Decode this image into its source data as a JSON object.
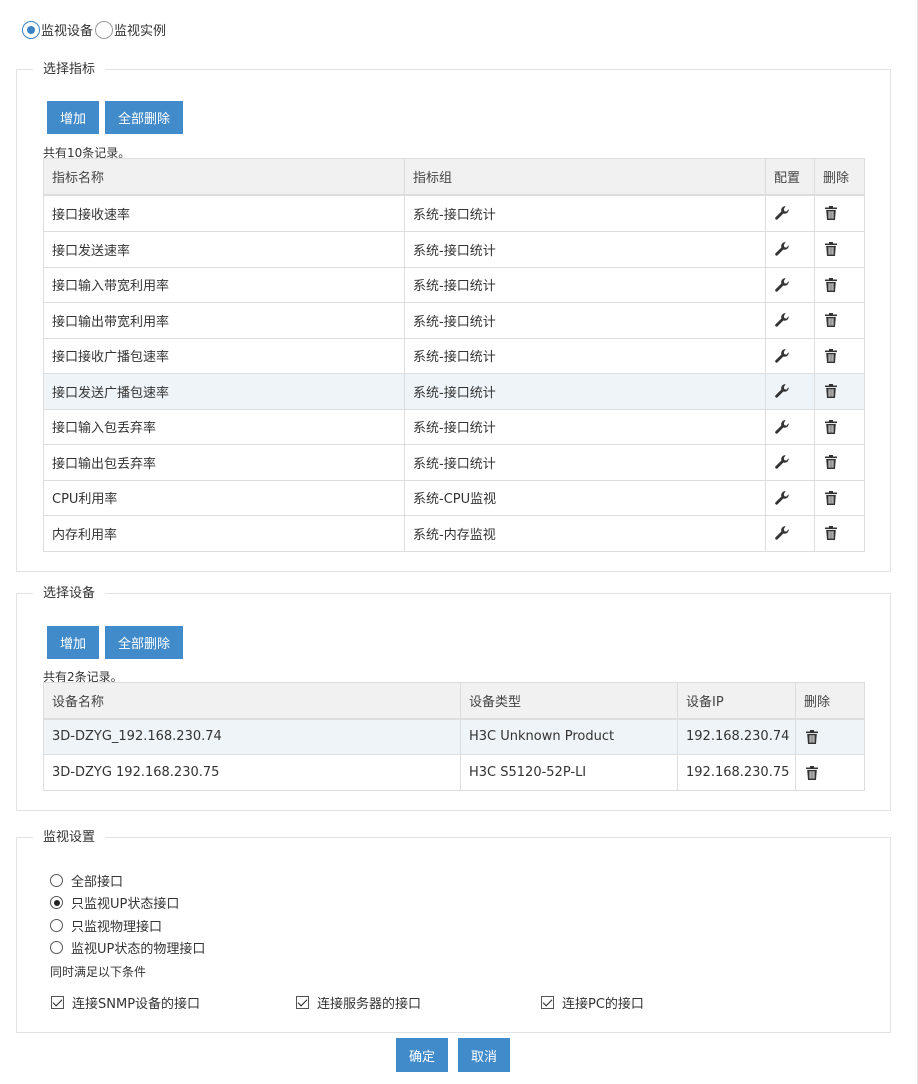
{
  "mode": {
    "options": [
      "监视设备",
      "监视实例"
    ],
    "selected": 0
  },
  "metrics": {
    "legend": "选择指标",
    "add_label": "增加",
    "delete_all_label": "全部删除",
    "count_text": "共有10条记录。",
    "headers": [
      "指标名称",
      "指标组",
      "配置",
      "删除"
    ],
    "rows": [
      {
        "name": "接口接收速率",
        "group": "系统-接口统计"
      },
      {
        "name": "接口发送速率",
        "group": "系统-接口统计"
      },
      {
        "name": "接口输入带宽利用率",
        "group": "系统-接口统计"
      },
      {
        "name": "接口输出带宽利用率",
        "group": "系统-接口统计"
      },
      {
        "name": "接口接收广播包速率",
        "group": "系统-接口统计"
      },
      {
        "name": "接口发送广播包速率",
        "group": "系统-接口统计"
      },
      {
        "name": "接口输入包丢弃率",
        "group": "系统-接口统计"
      },
      {
        "name": "接口输出包丢弃率",
        "group": "系统-接口统计"
      },
      {
        "name": "CPU利用率",
        "group": "系统-CPU监视"
      },
      {
        "name": "内存利用率",
        "group": "系统-内存监视"
      }
    ]
  },
  "devices": {
    "legend": "选择设备",
    "add_label": "增加",
    "delete_all_label": "全部删除",
    "count_text": "共有2条记录。",
    "headers": [
      "设备名称",
      "设备类型",
      "设备IP",
      "删除"
    ],
    "rows": [
      {
        "name": "3D-DZYG_192.168.230.74",
        "type": "H3C Unknown Product",
        "ip": "192.168.230.74"
      },
      {
        "name": "3D-DZYG 192.168.230.75",
        "type": "H3C S5120-52P-LI",
        "ip": "192.168.230.75"
      }
    ]
  },
  "monitor": {
    "legend": "监视设置",
    "options": [
      "全部接口",
      "只监视UP状态接口",
      "只监视物理接口",
      "监视UP状态的物理接口"
    ],
    "selected": 1,
    "conditions_title": "同时满足以下条件",
    "conditions": [
      "连接SNMP设备的接口",
      "连接服务器的接口",
      "连接PC的接口"
    ]
  },
  "footer": {
    "ok_label": "确定",
    "cancel_label": "取消"
  },
  "icons": {
    "config": "wrench-icon",
    "delete": "trash-icon"
  },
  "colors": {
    "primary": "#428bca",
    "highlight_row": "#eef4f8"
  }
}
